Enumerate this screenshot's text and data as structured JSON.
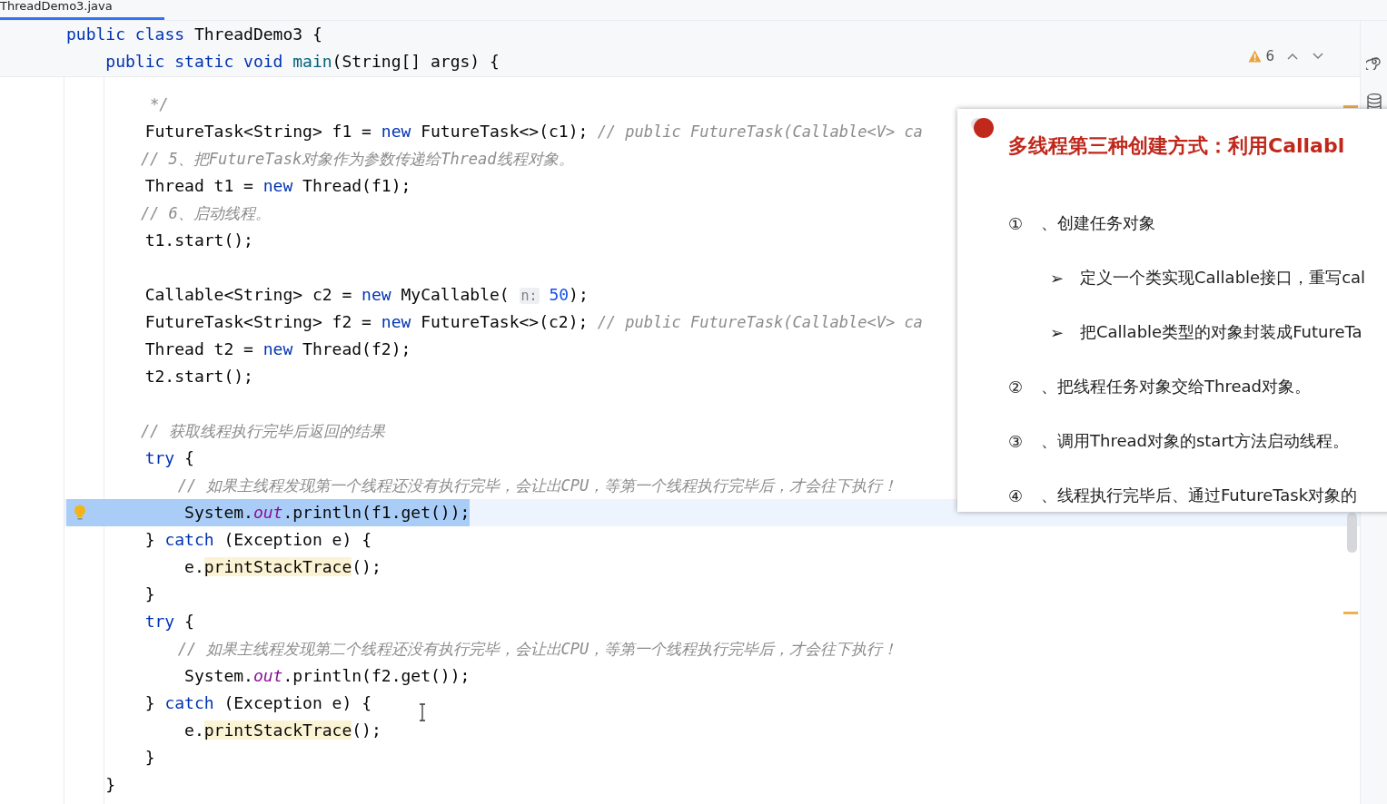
{
  "tab": {
    "label": "ThreadDemo3.java",
    "selected": true
  },
  "sticky_lines": [
    [
      {
        "kind": "kw",
        "text": "public"
      },
      {
        "kind": "kw",
        "text": " class"
      },
      {
        "kind": "p",
        "text": " ThreadDemo3 {"
      }
    ],
    [
      {
        "kind": "kw",
        "text": "    public"
      },
      {
        "kind": "kw",
        "text": " static"
      },
      {
        "kind": "kw",
        "text": " void"
      },
      {
        "kind": "decl",
        "text": " main"
      },
      {
        "kind": "p",
        "text": "(String[] args) {"
      }
    ]
  ],
  "inspection": {
    "warnings": "6"
  },
  "lines": [
    {
      "highlighted": false,
      "bulb": false
    },
    {
      "tokens": [
        {
          "kind": "c",
          "text": "         */"
        }
      ],
      "highlighted": false,
      "bulb": false
    },
    {
      "tokens": [
        {
          "kind": "p",
          "text": "        FutureTask<String> f1 ="
        },
        {
          "kind": "kw",
          "text": " new"
        },
        {
          "kind": "p",
          "text": " FutureTask<>(c1);"
        },
        {
          "kind": "c",
          "text": " // public FutureTask(Callable<V> ca"
        }
      ],
      "highlighted": false,
      "bulb": false
    },
    {
      "tokens": [
        {
          "kind": "c",
          "text": "        // 5、把FutureTask对象作为参数传递给Thread线程对象。"
        }
      ],
      "highlighted": false,
      "bulb": false
    },
    {
      "tokens": [
        {
          "kind": "p",
          "text": "        Thread t1 ="
        },
        {
          "kind": "kw",
          "text": " new"
        },
        {
          "kind": "p",
          "text": " Thread(f1);"
        }
      ],
      "highlighted": false,
      "bulb": false
    },
    {
      "tokens": [
        {
          "kind": "c",
          "text": "        // 6、启动线程。"
        }
      ],
      "highlighted": false,
      "bulb": false
    },
    {
      "tokens": [
        {
          "kind": "p",
          "text": "        t1.start();"
        }
      ],
      "highlighted": false,
      "bulb": false
    },
    {
      "highlighted": false,
      "bulb": false
    },
    {
      "tokens": [
        {
          "kind": "p",
          "text": "        Callable<String> c2 ="
        },
        {
          "kind": "kw",
          "text": " new"
        },
        {
          "kind": "p",
          "text": " MyCallable( "
        },
        {
          "kind": "hint",
          "text": "n:"
        },
        {
          "kind": "num",
          "text": " 50"
        },
        {
          "kind": "p",
          "text": ");"
        }
      ],
      "highlighted": false,
      "bulb": false
    },
    {
      "tokens": [
        {
          "kind": "p",
          "text": "        FutureTask<String> f2 ="
        },
        {
          "kind": "kw",
          "text": " new"
        },
        {
          "kind": "p",
          "text": " FutureTask<>(c2);"
        },
        {
          "kind": "c",
          "text": " // public FutureTask(Callable<V> ca"
        }
      ],
      "highlighted": false,
      "bulb": false
    },
    {
      "tokens": [
        {
          "kind": "p",
          "text": "        Thread t2 ="
        },
        {
          "kind": "kw",
          "text": " new"
        },
        {
          "kind": "p",
          "text": " Thread(f2);"
        }
      ],
      "highlighted": false,
      "bulb": false
    },
    {
      "tokens": [
        {
          "kind": "p",
          "text": "        t2.start();"
        }
      ],
      "highlighted": false,
      "bulb": false
    },
    {
      "highlighted": false,
      "bulb": false
    },
    {
      "tokens": [
        {
          "kind": "c",
          "text": "        // 获取线程执行完毕后返回的结果"
        }
      ],
      "highlighted": false,
      "bulb": false
    },
    {
      "tokens": [
        {
          "kind": "kw",
          "text": "        try"
        },
        {
          "kind": "p",
          "text": " {"
        }
      ],
      "highlighted": false,
      "bulb": false
    },
    {
      "tokens": [
        {
          "kind": "c",
          "text": "            // 如果主线程发现第一个线程还没有执行完毕，会让出CPU，等第一个线程执行完毕后，才会往下执行！"
        }
      ],
      "highlighted": false,
      "bulb": false
    },
    {
      "tokens": [
        {
          "kind": "p",
          "text": "            System."
        },
        {
          "kind": "field",
          "text": "out"
        },
        {
          "kind": "p",
          "text": ".println(f1.get());"
        }
      ],
      "highlighted": true,
      "bulb": true
    },
    {
      "tokens": [
        {
          "kind": "p",
          "text": "        }"
        },
        {
          "kind": "kw",
          "text": " catch"
        },
        {
          "kind": "p",
          "text": " (Exception e) {"
        }
      ],
      "highlighted": false,
      "bulb": false
    },
    {
      "tokens": [
        {
          "kind": "p",
          "text": "            e."
        },
        {
          "kind": "usage",
          "text": "printStackTrace"
        },
        {
          "kind": "p",
          "text": "();"
        }
      ],
      "highlighted": false,
      "bulb": false
    },
    {
      "tokens": [
        {
          "kind": "p",
          "text": "        }"
        }
      ],
      "highlighted": false,
      "bulb": false
    },
    {
      "tokens": [
        {
          "kind": "kw",
          "text": "        try"
        },
        {
          "kind": "p",
          "text": " {"
        }
      ],
      "highlighted": false,
      "bulb": false
    },
    {
      "tokens": [
        {
          "kind": "c",
          "text": "            // 如果主线程发现第二个线程还没有执行完毕，会让出CPU，等第一个线程执行完毕后，才会往下执行！"
        }
      ],
      "highlighted": false,
      "bulb": false
    },
    {
      "tokens": [
        {
          "kind": "p",
          "text": "            System."
        },
        {
          "kind": "field",
          "text": "out"
        },
        {
          "kind": "p",
          "text": ".println(f2.get());"
        }
      ],
      "highlighted": false,
      "bulb": false
    },
    {
      "tokens": [
        {
          "kind": "p",
          "text": "        }"
        },
        {
          "kind": "kw",
          "text": " catch"
        },
        {
          "kind": "p",
          "text": " (Exception e) {"
        }
      ],
      "highlighted": false,
      "bulb": false
    },
    {
      "tokens": [
        {
          "kind": "p",
          "text": "            e."
        },
        {
          "kind": "usage",
          "text": "printStackTrace"
        },
        {
          "kind": "p",
          "text": "();"
        }
      ],
      "highlighted": false,
      "bulb": false
    },
    {
      "tokens": [
        {
          "kind": "p",
          "text": "        }"
        }
      ],
      "highlighted": false,
      "bulb": false
    },
    {
      "tokens": [
        {
          "kind": "p",
          "text": "    }"
        }
      ],
      "highlighted": false,
      "bulb": false
    }
  ],
  "slide": {
    "title": "多线程第三种创建方式：利用Callabl",
    "items": [
      {
        "kind": "step",
        "marker": "①",
        "text": "、创建任务对象"
      },
      {
        "kind": "bullet",
        "marker": "➢",
        "text": "定义一个类实现Callable接口，重写cal"
      },
      {
        "kind": "bullet",
        "marker": "➢",
        "text": "把Callable类型的对象封装成FutureTa"
      },
      {
        "kind": "step",
        "marker": "②",
        "text": "、把线程任务对象交给Thread对象。"
      },
      {
        "kind": "step",
        "marker": "③",
        "text": "、调用Thread对象的start方法启动线程。"
      },
      {
        "kind": "step",
        "marker": "④",
        "text": "、线程执行完毕后、通过FutureTask对象的"
      }
    ]
  }
}
